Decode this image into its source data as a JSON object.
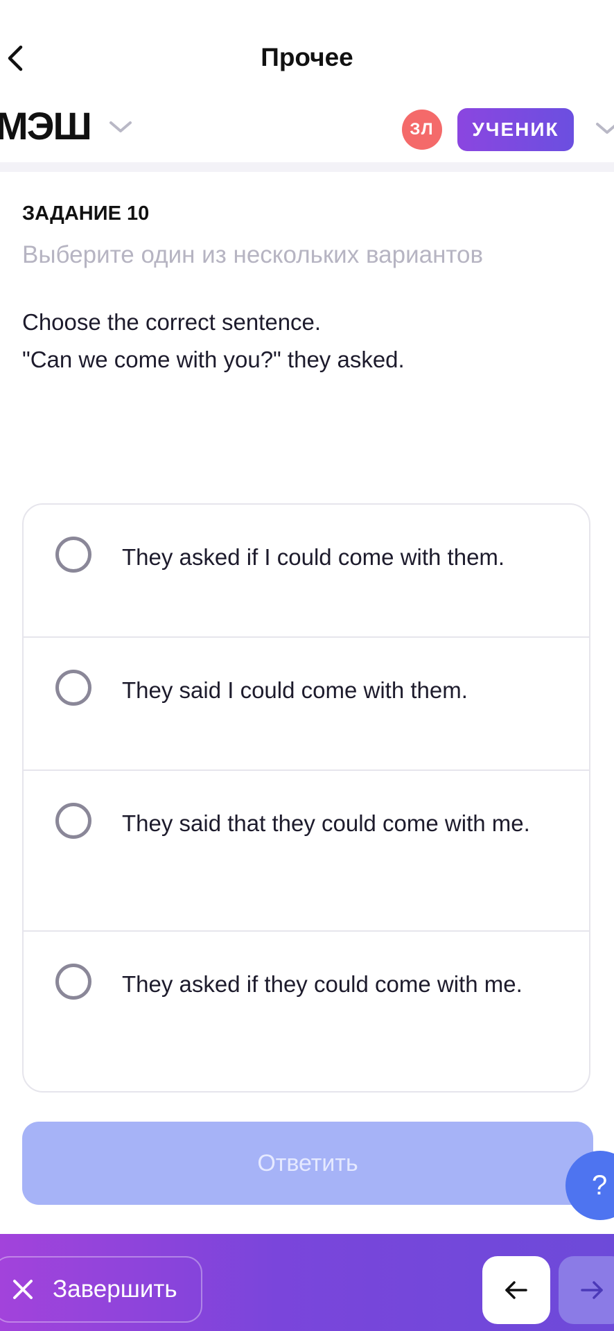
{
  "header": {
    "title": "Прочее",
    "brand": "МЭШ",
    "avatar_initials": "ЗЛ",
    "role": "УЧЕНИК"
  },
  "task": {
    "label": "ЗАДАНИЕ 10",
    "hint": "Выберите один из нескольких вариантов",
    "question_line1": "Choose the correct sentence.",
    "question_line2": "\"Can we come with you?\" they asked."
  },
  "options": [
    {
      "text": "They asked if I could come with them.",
      "selected": false
    },
    {
      "text": "They said I could come with them.",
      "selected": false
    },
    {
      "text": "They said that they could come with me.",
      "selected": false
    },
    {
      "text": "They asked if they could come with me.",
      "selected": false
    }
  ],
  "answer_button": "Ответить",
  "help_button": "?",
  "footer": {
    "finish_label": "Завершить"
  },
  "icons": {
    "back": "chevron-left-icon",
    "brand_menu": "chevron-down-icon",
    "role_menu": "chevron-down-icon",
    "finish": "close-icon",
    "prev": "arrow-left-icon",
    "next": "arrow-right-icon"
  },
  "colors": {
    "accent_purple": "#8b46e0",
    "answer_disabled": "#a6b3f7",
    "help_blue": "#4e74f0",
    "avatar_red": "#f46a6a"
  }
}
